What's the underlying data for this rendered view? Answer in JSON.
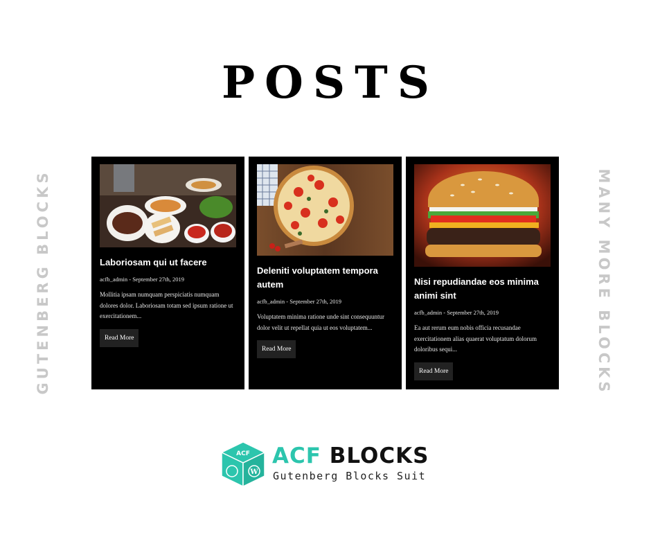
{
  "header": {
    "title": "POSTS"
  },
  "side_labels": {
    "left": "GUTENBERG BLOCKS",
    "right": "MANY MORE BLOCKS"
  },
  "posts": [
    {
      "title": "Laboriosam qui ut facere",
      "meta": "acfb_admin - September 27th, 2019",
      "excerpt": "Mollitia ipsam numquam perspiciatis numquam dolores dolor. Laboriosam totam sed ipsum ratione ut exercitationem...",
      "button": "Read More"
    },
    {
      "title": "Deleniti voluptatem tempora autem",
      "meta": "acfb_admin - September 27th, 2019",
      "excerpt": "Voluptatem minima ratione unde sint consequuntur dolor velit ut repellat quia ut eos voluptatem...",
      "button": "Read More"
    },
    {
      "title": "Nisi repudiandae eos minima animi sint",
      "meta": "acfb_admin - September 27th, 2019",
      "excerpt": "Ea aut rerum eum nobis officia recusandae exercitationem alias quaerat voluptatum dolorum doloribus sequi...",
      "button": "Read More"
    }
  ],
  "brand": {
    "name_accent": "ACF",
    "name_rest": "BLOCKS",
    "tagline": "Gutenberg Blocks Suit",
    "cube_text": "ACF",
    "accent_color": "#2cc5ad",
    "dark_color": "#111111"
  }
}
